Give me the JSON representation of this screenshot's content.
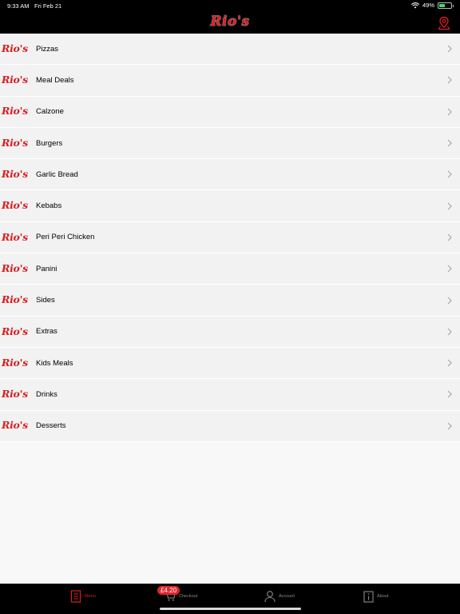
{
  "status": {
    "time": "9:33 AM",
    "date": "Fri Feb 21",
    "battery": "49%",
    "battery_level": 0.49
  },
  "header": {
    "logo": "Rio's"
  },
  "row_logo": "Rio's",
  "menu": {
    "items": [
      {
        "label": "Pizzas"
      },
      {
        "label": "Meal Deals"
      },
      {
        "label": "Calzone"
      },
      {
        "label": "Burgers"
      },
      {
        "label": "Garlic Bread"
      },
      {
        "label": "Kebabs"
      },
      {
        "label": "Peri Peri Chicken"
      },
      {
        "label": "Panini"
      },
      {
        "label": "Sides"
      },
      {
        "label": "Extras"
      },
      {
        "label": "Kids Meals"
      },
      {
        "label": "Drinks"
      },
      {
        "label": "Desserts"
      }
    ]
  },
  "tabs": {
    "menu": "Menu",
    "checkout": "Checkout",
    "account": "Account",
    "about": "About",
    "cart_badge": "£4.20"
  },
  "colors": {
    "brand_red": "#d81e22",
    "bar_black": "#000000",
    "row_bg": "#f2f2f2"
  },
  "icons": {
    "location": "map-pin-icon",
    "menu": "document-icon",
    "checkout": "cart-icon",
    "account": "person-icon",
    "about": "info-icon",
    "chevron": "chevron-right-icon"
  }
}
